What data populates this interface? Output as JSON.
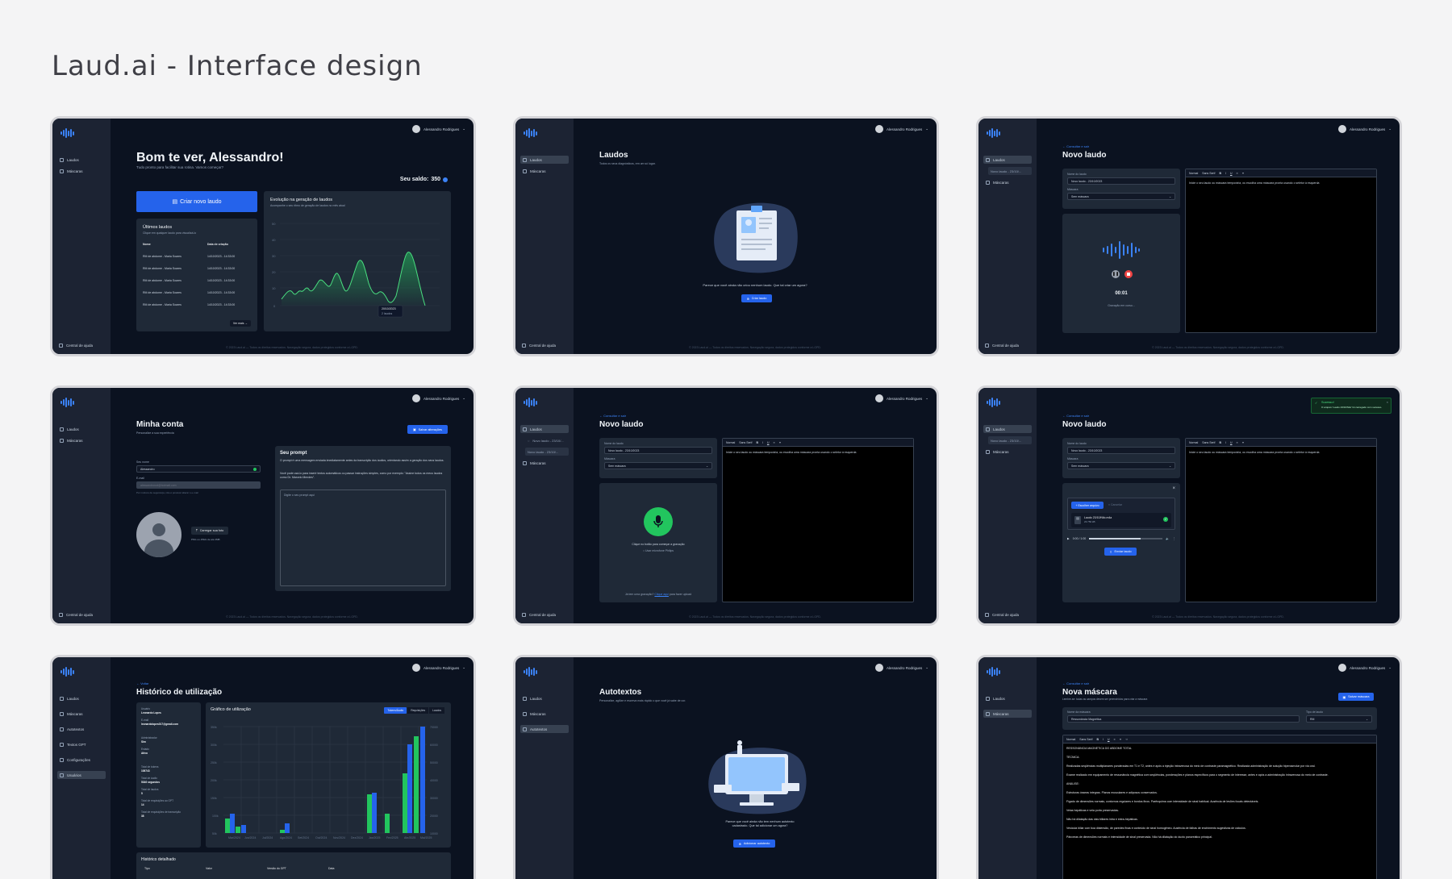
{
  "page_title": "Laud.ai - Interface design",
  "common": {
    "user_name": "Alessandro Rodrigues",
    "nav_laudos": "Laudos",
    "nav_mascaras": "Máscaras",
    "nav_autotextos": "Autotextos",
    "nav_textos_gpt": "Textos GPT",
    "nav_config": "Configurações",
    "nav_usuarios": "Usuários",
    "help": "Central de ajuda",
    "footer": "© 2023 Laud.ai — Todos os direitos reservados. Navegação segura, dados protegidos conforme a LGPD.",
    "back_laudos": "← Consultar e sair",
    "back": "← Voltar",
    "accent": "#2563eb"
  },
  "dashboard": {
    "greeting": "Bom te ver, Alessandro!",
    "subtitle": "Tudo pronto para facilitar sua rotina. Vamos começar?",
    "balance_label": "Seu saldo:",
    "balance_value": "350",
    "create_button": "Criar novo laudo",
    "recent_title": "Últimos laudos",
    "recent_sub": "Clique em qualquer laudo para visualizá-lo",
    "col_name": "Nome",
    "col_date": "Data de criação",
    "rows": [
      {
        "name": "RM de abdome - Maria Soares",
        "date": "14/10/2023 - 14:33:00"
      },
      {
        "name": "RM de abdome - Maria Soares",
        "date": "14/10/2023 - 14:33:00"
      },
      {
        "name": "RM de abdome - Maria Soares",
        "date": "14/10/2023 - 14:33:00"
      },
      {
        "name": "RM de abdome - Maria Soares",
        "date": "14/10/2023 - 14:33:00"
      },
      {
        "name": "RM de abdome - Maria Soares",
        "date": "14/10/2023 - 14:33:00"
      }
    ],
    "see_more": "Ver mais →",
    "chart_title": "Evolução na geração de laudos",
    "chart_sub": "Acompanhe o seu ritmo de geração de laudos no mês atual",
    "tooltip_date": "20/10/2023",
    "tooltip_value": "2 laudos"
  },
  "laudos": {
    "title": "Laudos",
    "subtitle": "Todos os seus diagnósticos, em um só lugar.",
    "empty": "Parece que você ainda não criou nenhum laudo. Que tal criar um agora?",
    "create": "Criar laudo"
  },
  "novo_laudo": {
    "title": "Novo laudo",
    "name_label": "Nome do laudo",
    "name_value": "Novo laudo - 23/10/2023",
    "mask_label": "Máscara",
    "mask_value": "Sem máscara",
    "editor_text": "Inicie o seu laudo ou máscara temporária, ou escolha uma máscara pronta usando o seletor à esquerda",
    "font": "Normal",
    "font2": "Sans Serif",
    "timer": "00:01",
    "recording": "Gravação em curso...",
    "sidebar_item": "Novo laudo - 23/10/...",
    "mic_hint": "Clique no botão para começar a gravação",
    "pilot": "Usar microfone Philips",
    "recording_q": "Já tem uma gravação?",
    "click_here": "Clique aqui",
    "upload_suffix": "para fazer upload",
    "choose_file": "+ Escolher arquivo",
    "cancel": "× Cancelar",
    "file_name": "Laudo 23/10/Nilo.m4a",
    "file_size": "23.750 kB",
    "audio_time": "0:00 / 1:00",
    "send": "Enviar laudo",
    "toast_title": "Sucesso!",
    "toast_text": "O arquivo 'Laudo 23/10/Nilo' foi carregado com sucesso."
  },
  "conta": {
    "title": "Minha conta",
    "subtitle": "Personalize a sua experiência",
    "save": "Salvar alterações",
    "name_label": "Seu nome",
    "name_value": "Alessandro",
    "email_label": "E-mail",
    "email_value": "alessandrorod@hotmail.com",
    "email_note": "Por motivos de segurança, não é possível alterar o e-mail",
    "photo_btn": "Carregar sua foto",
    "photo_note": "PNG ou JPEG de até 2MB",
    "prompt_title": "Seu prompt",
    "prompt_text1": "O prompt é uma mensagem enviada imediatamente antes da transcrição dos áudios, orientando assim a geração dos seus laudos.",
    "prompt_text2": "Você pode usá-lo para inserir textos automáticos ou passar instruções simples, como por exemplo: \"Assine todos os meus laudos como Dr. Marcelo Mendes\".",
    "prompt_placeholder": "Digite o seu prompt aqui"
  },
  "historico": {
    "title": "Histórico de utilização",
    "user_label": "Usuário",
    "user_value": "Leonardo Lopes",
    "email_label": "E-mail",
    "email_value": "leonardolopes017@gmail.com",
    "admin_label": "Administrador",
    "admin_value": "Sim",
    "status_label": "Estado",
    "status_value": "Ativo",
    "tokens_label": "Total de tokens",
    "tokens_value": "108743",
    "audio_label": "Total de áudio",
    "audio_value": "5346 segundos",
    "laudos_label": "Total de laudos",
    "laudos_value": "5",
    "gpt_label": "Total de requisições ao GPT",
    "gpt_value": "14",
    "trans_label": "Total de requisições de transcrição",
    "trans_value": "38",
    "chart_title": "Gráfico de utilização",
    "tab1": "Tokens/Áudio",
    "tab2": "Requisições",
    "tab3": "Laudos",
    "detail_title": "Histórico detalhado",
    "col_type": "Tipo",
    "col_value": "Valor",
    "col_gpt": "Versão do GPT",
    "col_date": "Data"
  },
  "autotextos": {
    "title": "Autotextos",
    "subtitle": "Personalize, agilize e escreva mais rápido o que você já sabe de cor.",
    "empty": "Parece que você ainda não tem nenhum autotexto cadastrado. Que tal adicionar um agora?",
    "add": "Adicionar autotexto"
  },
  "mascara": {
    "title": "Nova máscara",
    "subtitle": "Lembre-se: todas as campos devem ser preenchidos para criar a máscara",
    "save": "Salvar máscara",
    "name_label": "Nome da máscara",
    "name_value": "Ressonância Magnética",
    "type_label": "Tipo de laudo",
    "type_value": "RM",
    "lines": [
      "RESSONÂNCIA MAGNÉTICA DO ABDOME TOTAL",
      "TÉCNICA:",
      "Realizadas seqüências multiplanares ponderadas em T1 e T2, antes e após a injeção intravenosa do meio de contraste paramagnético. Realizada administração de solução hiperosmolar por via oral.",
      "Exame realizado em equipamento de ressonância magnética com seqüências, ponderações e planos específicos para o segmento de interesse, antes e após a administração intravenosa do meio de contraste.",
      "ANÁLISE:",
      "Estruturas ósseas íntegras. Planos musculares e adiposos conservados.",
      "Fígado de dimensões normais, contornos regulares e bordos finos. Parênquima com intensidade de sinal habitual. Ausência de lesões focais detectáveis.",
      "Veias hepáticas e veia porta preservadas.",
      "Não há dilatação das vias biliares intra e extra-hepáticas.",
      "Vesícula biliar com boa distensão, de paredes finas e conteúdo de sinal homogêneo. Ausência de falhas de enchimento sugestivas de cálculos.",
      "Pâncreas de dimensões normais e intensidade de sinal preservada. Não há dilatação do ducto pancreático principal."
    ]
  }
}
